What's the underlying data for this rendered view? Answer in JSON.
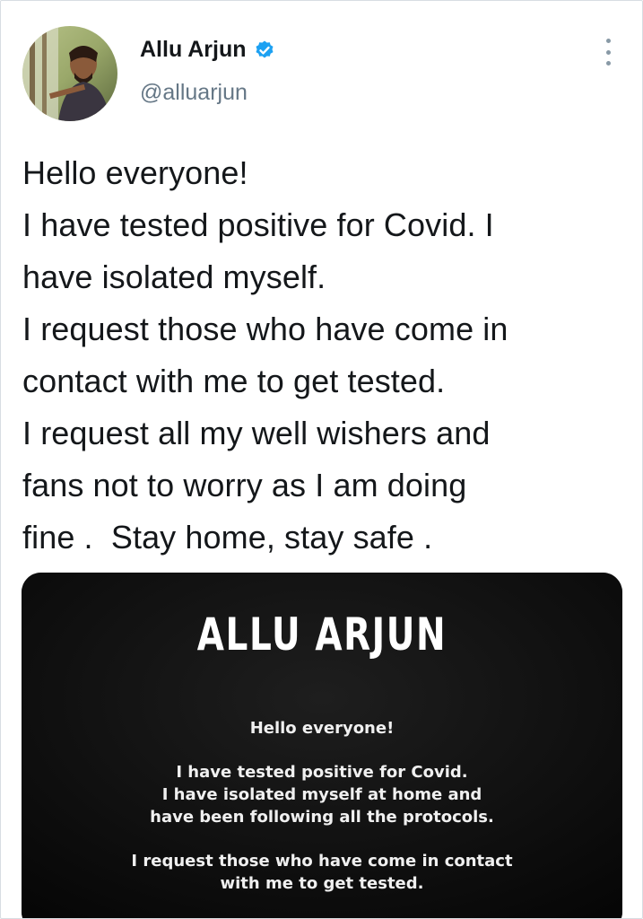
{
  "author": {
    "display_name": "Allu Arjun",
    "handle": "@alluarjun",
    "avatar_icon": "profile-photo",
    "verified_icon": "verified-badge-icon",
    "verified_color": "#1da1f2"
  },
  "menu_icon": "more-vertical-icon",
  "tweet": {
    "text_lines": [
      "Hello everyone!",
      "I have tested positive for Covid. I",
      "have isolated myself.",
      "I request those who have come in",
      "contact with me to get tested.",
      "I request all my well wishers and",
      "fans not to worry as I am doing",
      "fine .  Stay home, stay safe ."
    ]
  },
  "media": {
    "title": "ALLU ARJUN",
    "lines": [
      "Hello everyone!",
      "I have tested positive for Covid.",
      "I have isolated myself at home and",
      "have been following all the protocols.",
      "I request those who have come in contact",
      "with me to get tested."
    ]
  }
}
